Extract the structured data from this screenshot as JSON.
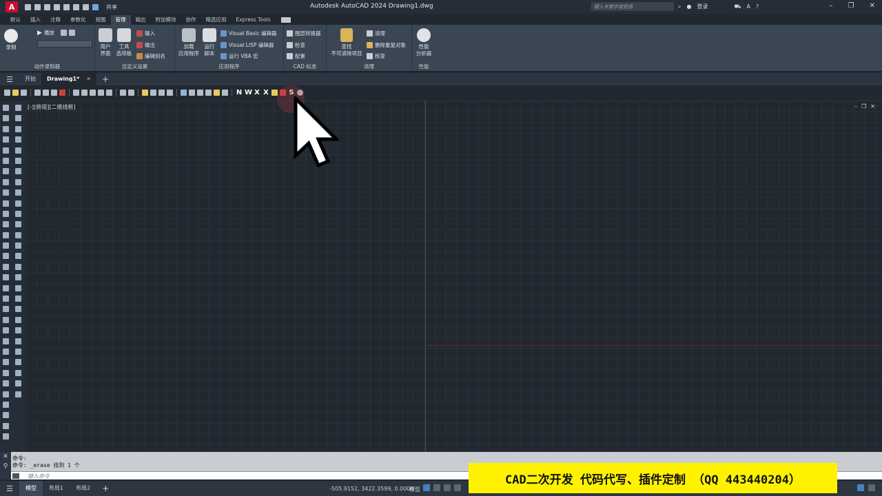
{
  "titlebar": {
    "app_letter": "A",
    "share_label": "共享",
    "title": "Autodesk AutoCAD 2024   Drawing1.dwg",
    "search_placeholder": "键入关键字或短语",
    "signin_label": "登录"
  },
  "ribbon_tabs": [
    "默认",
    "插入",
    "注释",
    "参数化",
    "视图",
    "管理",
    "输出",
    "附加模块",
    "协作",
    "精选应用",
    "Express Tools"
  ],
  "active_ribbon_tab": "管理",
  "ribbon": {
    "action_recorder": {
      "record_label": "录制",
      "play_label": "播放",
      "panel_label": "动作录制器"
    },
    "customization": {
      "ui_label1": "用户",
      "ui_label2": "界面",
      "tool_label1": "工具",
      "tool_label2": "选项板",
      "import_label": "输入",
      "export_label": "输出",
      "alias_label": "编辑别名",
      "panel_label": "自定义设置"
    },
    "applications": {
      "load_label1": "加载",
      "load_label2": "应用程序",
      "run_label1": "运行",
      "run_label2": "脚本",
      "vba_editor": "Visual Basic 编辑器",
      "lisp_editor": "Visual LISP 编辑器",
      "run_vba": "运行 VBA 宏",
      "panel_label": "应用程序"
    },
    "cad_standards": {
      "layer_translator": "图层转换器",
      "check": "检查",
      "configure": "配置",
      "panel_label": "CAD 标准"
    },
    "cleanup": {
      "find_label1": "查找",
      "find_label2": "不可清除项目",
      "purge": "清理",
      "overkill": "删除重复对象",
      "audit": "核查",
      "panel_label": "清理"
    },
    "performance": {
      "analyzer_label1": "性能",
      "analyzer_label2": "分析器",
      "panel_label": "性能"
    }
  },
  "file_tabs": {
    "start": "开始",
    "drawing": "Drawing1*"
  },
  "toolbar_letters": [
    "N",
    "W",
    "X",
    "X",
    "S"
  ],
  "viewport": {
    "label": "[-][俯视][二维线框]"
  },
  "command": {
    "line1": "命令:",
    "line2": "命令: _erase 找到 1 个",
    "placeholder": "键入命令"
  },
  "status": {
    "model_tab": "模型",
    "layout1": "布局1",
    "layout2": "布局2",
    "coords": "-505.9152, 3422.3599, 0.0000",
    "model_label": "模型"
  },
  "promo": {
    "text": "CAD二次开发 代码代写、插件定制 （QQ 443440204）"
  },
  "colors": {
    "accent": "#c8102e",
    "banner": "#fff200",
    "canvas": "#212830"
  }
}
